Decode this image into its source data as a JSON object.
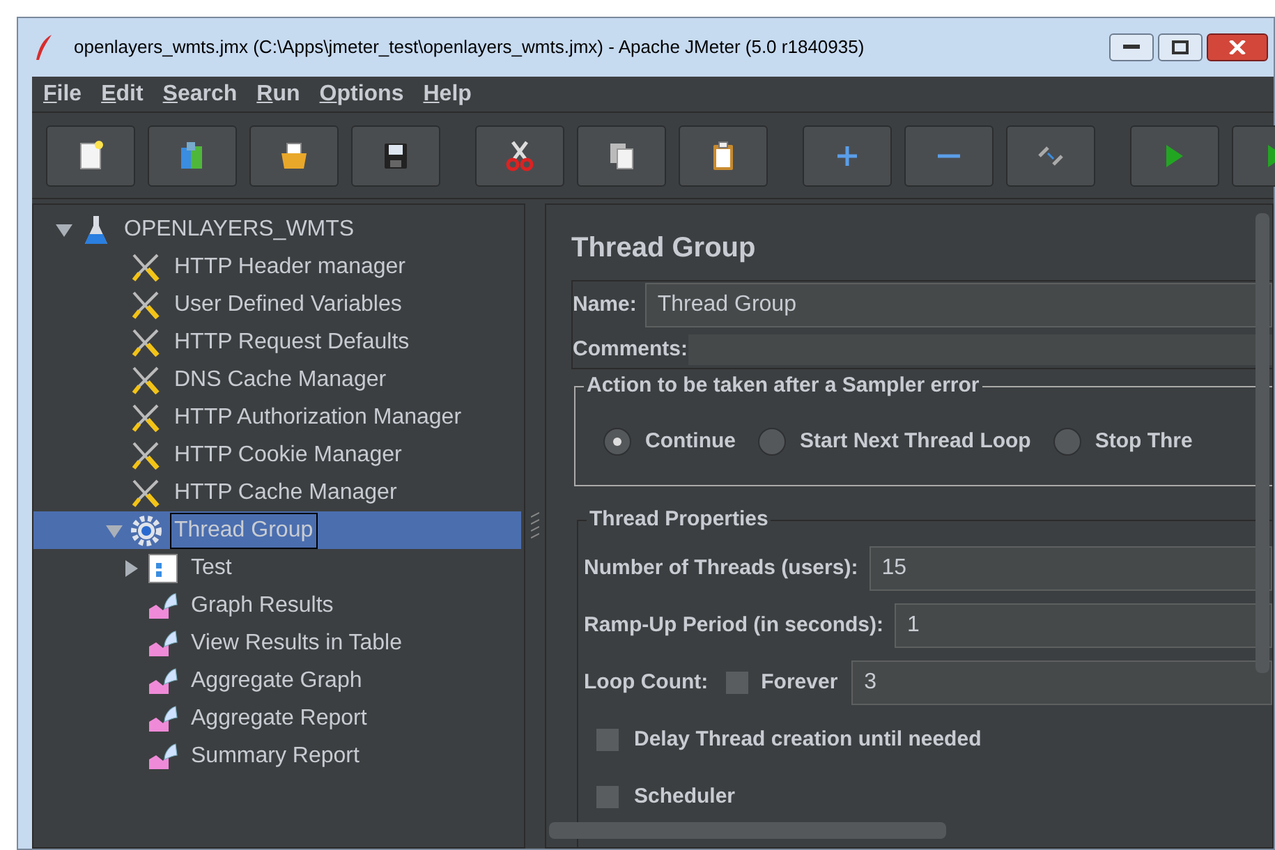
{
  "window": {
    "title": "openlayers_wmts.jmx (C:\\Apps\\jmeter_test\\openlayers_wmts.jmx) - Apache JMeter (5.0 r1840935)"
  },
  "menu": [
    {
      "label": "File"
    },
    {
      "label": "Edit"
    },
    {
      "label": "Search"
    },
    {
      "label": "Run"
    },
    {
      "label": "Options"
    },
    {
      "label": "Help"
    }
  ],
  "toolbar": [
    {
      "kind": "new"
    },
    {
      "kind": "templates"
    },
    {
      "kind": "open"
    },
    {
      "kind": "save"
    },
    {
      "kind": "cut"
    },
    {
      "kind": "copy"
    },
    {
      "kind": "paste"
    },
    {
      "kind": "add"
    },
    {
      "kind": "remove"
    },
    {
      "kind": "toggle"
    },
    {
      "kind": "start"
    },
    {
      "kind": "start-no-pause"
    }
  ],
  "tree": [
    {
      "label": "OPENLAYERS_WMTS",
      "kind": "plan",
      "expanded": true,
      "selected": false,
      "children": [
        {
          "label": "HTTP Header manager",
          "kind": "config",
          "selected": false
        },
        {
          "label": "User Defined Variables",
          "kind": "config",
          "selected": false
        },
        {
          "label": "HTTP Request Defaults",
          "kind": "config",
          "selected": false
        },
        {
          "label": "DNS Cache Manager",
          "kind": "config",
          "selected": false
        },
        {
          "label": "HTTP Authorization Manager",
          "kind": "config",
          "selected": false
        },
        {
          "label": "HTTP Cookie Manager",
          "kind": "config",
          "selected": false
        },
        {
          "label": "HTTP Cache Manager",
          "kind": "config",
          "selected": false
        },
        {
          "label": "Thread Group",
          "kind": "thread",
          "expanded": true,
          "selected": true,
          "children": [
            {
              "label": "Test",
              "kind": "controller",
              "expanded": false,
              "selected": false
            },
            {
              "label": "Graph Results",
              "kind": "listener",
              "selected": false
            },
            {
              "label": "View Results in Table",
              "kind": "listener",
              "selected": false
            },
            {
              "label": "Aggregate Graph",
              "kind": "listener",
              "selected": false
            },
            {
              "label": "Aggregate Report",
              "kind": "listener",
              "selected": false
            },
            {
              "label": "Summary Report",
              "kind": "listener",
              "selected": false
            }
          ]
        }
      ]
    }
  ],
  "panel": {
    "title": "Thread Group",
    "name_label": "Name:",
    "name_value": "Thread Group",
    "comments_label": "Comments:",
    "error_group": {
      "title": "Action to be taken after a Sampler error",
      "options": [
        {
          "label": "Continue",
          "selected": true
        },
        {
          "label": "Start Next Thread Loop",
          "selected": false
        },
        {
          "label": "Stop Thre",
          "selected": false
        }
      ]
    },
    "properties": {
      "title": "Thread Properties",
      "threads_label": "Number of Threads (users):",
      "threads_value": "15",
      "rampup_label": "Ramp-Up Period (in seconds):",
      "rampup_value": "1",
      "loop_label": "Loop Count:",
      "forever": {
        "label": "Forever",
        "checked": false
      },
      "loop_value": "3",
      "checkboxes": [
        {
          "label": "Delay Thread creation until needed",
          "checked": false
        },
        {
          "label": "Scheduler",
          "checked": false
        }
      ]
    }
  }
}
